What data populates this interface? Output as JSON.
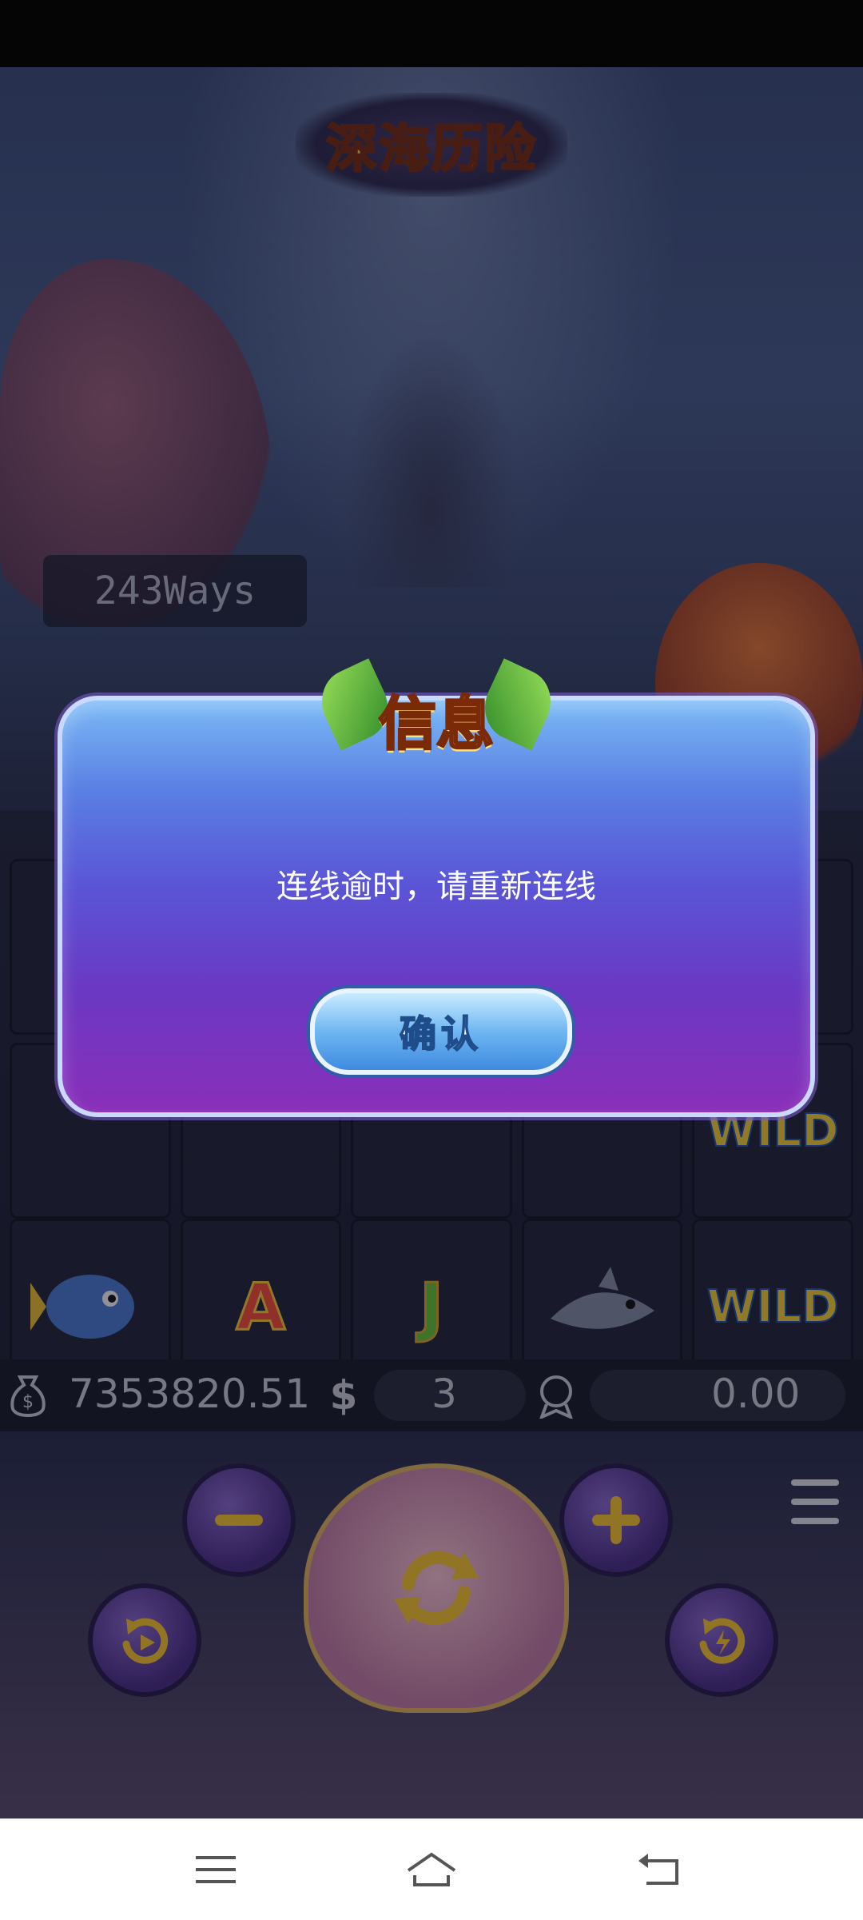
{
  "game": {
    "title": "深海历险",
    "ways_label": "243Ways"
  },
  "dialog": {
    "title": "信息",
    "message": "连线逾时，请重新连线",
    "confirm_label": "确认"
  },
  "balance_bar": {
    "balance": "7353820.51",
    "bet": "3",
    "win": "0.00"
  },
  "reels": {
    "bottom_row": [
      "fish",
      "A",
      "J",
      "shark",
      "WILD"
    ],
    "wild_label": "WILD"
  },
  "icons": {
    "balance": "money-bag-icon",
    "bet": "dollar-icon",
    "win": "trophy-icon",
    "minus": "minus-icon",
    "plus": "plus-icon",
    "spin": "spin-icon",
    "autoplay": "autoplay-icon",
    "turbo": "turbo-icon",
    "menu": "menu-icon"
  },
  "colors": {
    "dialog_top": "#7ab9f6",
    "dialog_bottom": "#8a2fb9",
    "title_gold": "#ffd24c"
  }
}
